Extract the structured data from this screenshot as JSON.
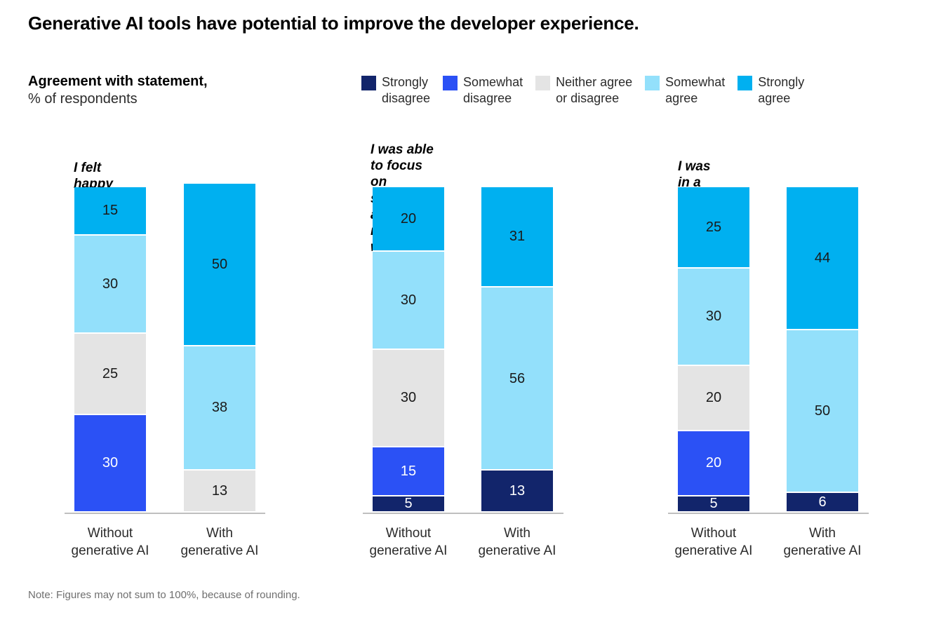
{
  "title": "Generative AI tools have potential to improve the developer experience.",
  "subtitle": {
    "main": "Agreement with statement,",
    "sub": "% of respondents"
  },
  "footnote": "Note: Figures may not sum to 100%, because of rounding.",
  "colors": {
    "strongly_disagree": "#12256b",
    "somewhat_disagree": "#2b51f5",
    "neither": "#e4e4e4",
    "somewhat_agree": "#93e0fb",
    "strongly_agree": "#00b0f0",
    "axis": "#bfbfbf",
    "label_dark": "#1a1a1a",
    "label_light": "#ffffff",
    "background": "#ffffff"
  },
  "legend": [
    {
      "label": "Strongly\ndisagree",
      "color": "#12256b",
      "key": "strongly_disagree"
    },
    {
      "label": "Somewhat\ndisagree",
      "color": "#2b51f5",
      "key": "somewhat_disagree"
    },
    {
      "label": "Neither agree\nor disagree",
      "color": "#e4e4e4",
      "key": "neither"
    },
    {
      "label": "Somewhat\nagree",
      "color": "#93e0fb",
      "key": "somewhat_agree"
    },
    {
      "label": "Strongly\nagree",
      "color": "#00b0f0",
      "key": "strongly_agree"
    }
  ],
  "groups": [
    {
      "title": "I felt happy",
      "bars": [
        {
          "category": "Without\ngenerative AI",
          "segments": [
            0,
            30,
            25,
            30,
            15
          ]
        },
        {
          "category": "With\ngenerative AI",
          "segments": [
            0,
            0,
            13,
            38,
            50
          ]
        }
      ]
    },
    {
      "title": "I was able to focus on\nsatisfying and meaningful work",
      "bars": [
        {
          "category": "Without\ngenerative AI",
          "segments": [
            5,
            15,
            30,
            30,
            20
          ]
        },
        {
          "category": "With\ngenerative AI",
          "segments": [
            13,
            0,
            0,
            56,
            31
          ]
        }
      ]
    },
    {
      "title": "I was in a ‘flow’ state",
      "bars": [
        {
          "category": "Without\ngenerative AI",
          "segments": [
            5,
            20,
            20,
            30,
            25
          ]
        },
        {
          "category": "With\ngenerative AI",
          "segments": [
            6,
            0,
            0,
            50,
            44
          ]
        }
      ]
    }
  ],
  "chart_data": {
    "type": "bar",
    "title": "Generative AI tools have potential to improve the developer experience.",
    "subtitle": "Agreement with statement, % of respondents",
    "note": "Note: Figures may not sum to 100%, because of rounding.",
    "stacked": true,
    "orientation": "vertical",
    "ylabel": "% of respondents",
    "xlabel": "",
    "ylim": [
      0,
      101
    ],
    "grid": false,
    "legend_position": "top",
    "legend": [
      "Strongly disagree",
      "Somewhat disagree",
      "Neither agree or disagree",
      "Somewhat agree",
      "Strongly agree"
    ],
    "series": [
      {
        "name": "Strongly disagree",
        "color": "#12256b",
        "values": [
          0,
          0,
          5,
          13,
          5,
          6
        ]
      },
      {
        "name": "Somewhat disagree",
        "color": "#2b51f5",
        "values": [
          30,
          0,
          15,
          0,
          20,
          0
        ]
      },
      {
        "name": "Neither agree or disagree",
        "color": "#e4e4e4",
        "values": [
          25,
          13,
          30,
          0,
          20,
          0
        ]
      },
      {
        "name": "Somewhat agree",
        "color": "#93e0fb",
        "values": [
          30,
          38,
          30,
          56,
          30,
          50
        ]
      },
      {
        "name": "Strongly agree",
        "color": "#00b0f0",
        "values": [
          15,
          50,
          20,
          31,
          25,
          44
        ]
      }
    ],
    "categories": [
      "I felt happy — Without generative AI",
      "I felt happy — With generative AI",
      "I was able to focus on satisfying and meaningful work — Without generative AI",
      "I was able to focus on satisfying and meaningful work — With generative AI",
      "I was in a 'flow' state — Without generative AI",
      "I was in a 'flow' state — With generative AI"
    ],
    "panels": [
      {
        "title": "I felt happy",
        "categories": [
          "Without generative AI",
          "With generative AI"
        ],
        "values": {
          "Strongly disagree": [
            0,
            0
          ],
          "Somewhat disagree": [
            30,
            0
          ],
          "Neither agree or disagree": [
            25,
            13
          ],
          "Somewhat agree": [
            30,
            38
          ],
          "Strongly agree": [
            15,
            50
          ]
        }
      },
      {
        "title": "I was able to focus on satisfying and meaningful work",
        "categories": [
          "Without generative AI",
          "With generative AI"
        ],
        "values": {
          "Strongly disagree": [
            5,
            13
          ],
          "Somewhat disagree": [
            15,
            0
          ],
          "Neither agree or disagree": [
            30,
            0
          ],
          "Somewhat agree": [
            30,
            56
          ],
          "Strongly agree": [
            20,
            31
          ]
        }
      },
      {
        "title": "I was in a 'flow' state",
        "categories": [
          "Without generative AI",
          "With generative AI"
        ],
        "values": {
          "Strongly disagree": [
            5,
            6
          ],
          "Somewhat disagree": [
            20,
            0
          ],
          "Neither agree or disagree": [
            20,
            0
          ],
          "Somewhat agree": [
            30,
            50
          ],
          "Strongly agree": [
            25,
            44
          ]
        }
      }
    ]
  }
}
